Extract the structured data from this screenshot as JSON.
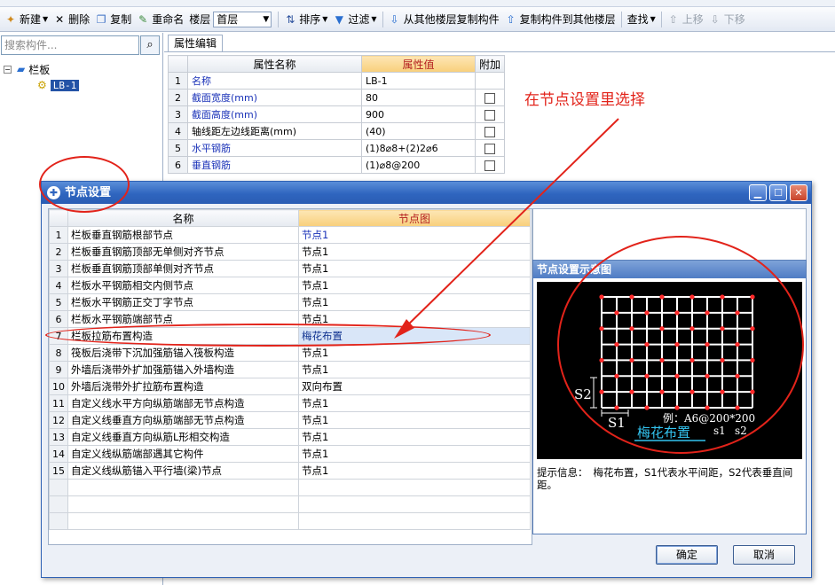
{
  "toolbar": {
    "new": "新建",
    "delete": "删除",
    "copy": "复制",
    "rename": "重命名",
    "floor_label": "楼层",
    "floor_value": "首层",
    "sort": "排序",
    "filter": "过滤",
    "copy_from_floor": "从其他楼层复制构件",
    "copy_to_floor": "复制构件到其他楼层",
    "find": "查找",
    "move_up": "上移",
    "move_down": "下移"
  },
  "search": {
    "placeholder": "搜索构件..."
  },
  "tree": {
    "root": "栏板",
    "child": "LB-1"
  },
  "property_tab": "属性编辑",
  "property_table": {
    "headers": [
      "属性名称",
      "属性值",
      "附加"
    ],
    "rows": [
      {
        "num": "1",
        "name": "名称",
        "value": "LB-1",
        "blue": true,
        "checkbox": false
      },
      {
        "num": "2",
        "name": "截面宽度(mm)",
        "value": "80",
        "blue": true,
        "checkbox": true
      },
      {
        "num": "3",
        "name": "截面高度(mm)",
        "value": "900",
        "blue": true,
        "checkbox": true
      },
      {
        "num": "4",
        "name": "轴线距左边线距离(mm)",
        "value": "(40)",
        "blue": false,
        "checkbox": true
      },
      {
        "num": "5",
        "name": "水平钢筋",
        "value": "(1)8⌀8+(2)2⌀6",
        "blue": true,
        "checkbox": true
      },
      {
        "num": "6",
        "name": "垂直钢筋",
        "value": "(1)⌀8@200",
        "blue": true,
        "checkbox": true
      }
    ]
  },
  "annotation": "在节点设置里选择",
  "dialog": {
    "title": "节点设置",
    "headers": [
      "名称",
      "节点图"
    ],
    "rows": [
      {
        "num": "1",
        "name": "栏板垂直钢筋根部节点",
        "value": "节点1",
        "blue": true
      },
      {
        "num": "2",
        "name": "栏板垂直钢筋顶部无单侧对齐节点",
        "value": "节点1",
        "blue": false
      },
      {
        "num": "3",
        "name": "栏板垂直钢筋顶部单侧对齐节点",
        "value": "节点1",
        "blue": false
      },
      {
        "num": "4",
        "name": "栏板水平钢筋相交内侧节点",
        "value": "节点1",
        "blue": false
      },
      {
        "num": "5",
        "name": "栏板水平钢筋正交丁字节点",
        "value": "节点1",
        "blue": false
      },
      {
        "num": "6",
        "name": "栏板水平钢筋端部节点",
        "value": "节点1",
        "blue": false
      },
      {
        "num": "7",
        "name": "栏板拉筋布置构造",
        "value": "梅花布置",
        "blue": false,
        "selected": true
      },
      {
        "num": "8",
        "name": "筏板后浇带下沉加强筋锚入筏板构造",
        "value": "节点1",
        "blue": false
      },
      {
        "num": "9",
        "name": "外墙后浇带外扩加强筋锚入外墙构造",
        "value": "节点1",
        "blue": false
      },
      {
        "num": "10",
        "name": "外墙后浇带外扩拉筋布置构造",
        "value": "双向布置",
        "blue": false
      },
      {
        "num": "11",
        "name": "自定义线水平方向纵筋端部无节点构造",
        "value": "节点1",
        "blue": false
      },
      {
        "num": "12",
        "name": "自定义线垂直方向纵筋端部无节点构造",
        "value": "节点1",
        "blue": false
      },
      {
        "num": "13",
        "name": "自定义线垂直方向纵筋L形相交构造",
        "value": "节点1",
        "blue": false
      },
      {
        "num": "14",
        "name": "自定义线纵筋端部遇其它构件",
        "value": "节点1",
        "blue": false
      },
      {
        "num": "15",
        "name": "自定义线纵筋锚入平行墙(梁)节点",
        "value": "节点1",
        "blue": false
      }
    ],
    "preview": {
      "header": "节点设置示意图",
      "label_s2": "S2",
      "label_s1": "S1",
      "example": "例：A6@200*200",
      "example_s1": "s1",
      "example_s2": "s2",
      "caption": "梅花布置"
    },
    "hint_label": "提示信息：",
    "hint_text": "梅花布置，S1代表水平间距，S2代表垂直间距。",
    "ok": "确定",
    "cancel": "取消"
  }
}
